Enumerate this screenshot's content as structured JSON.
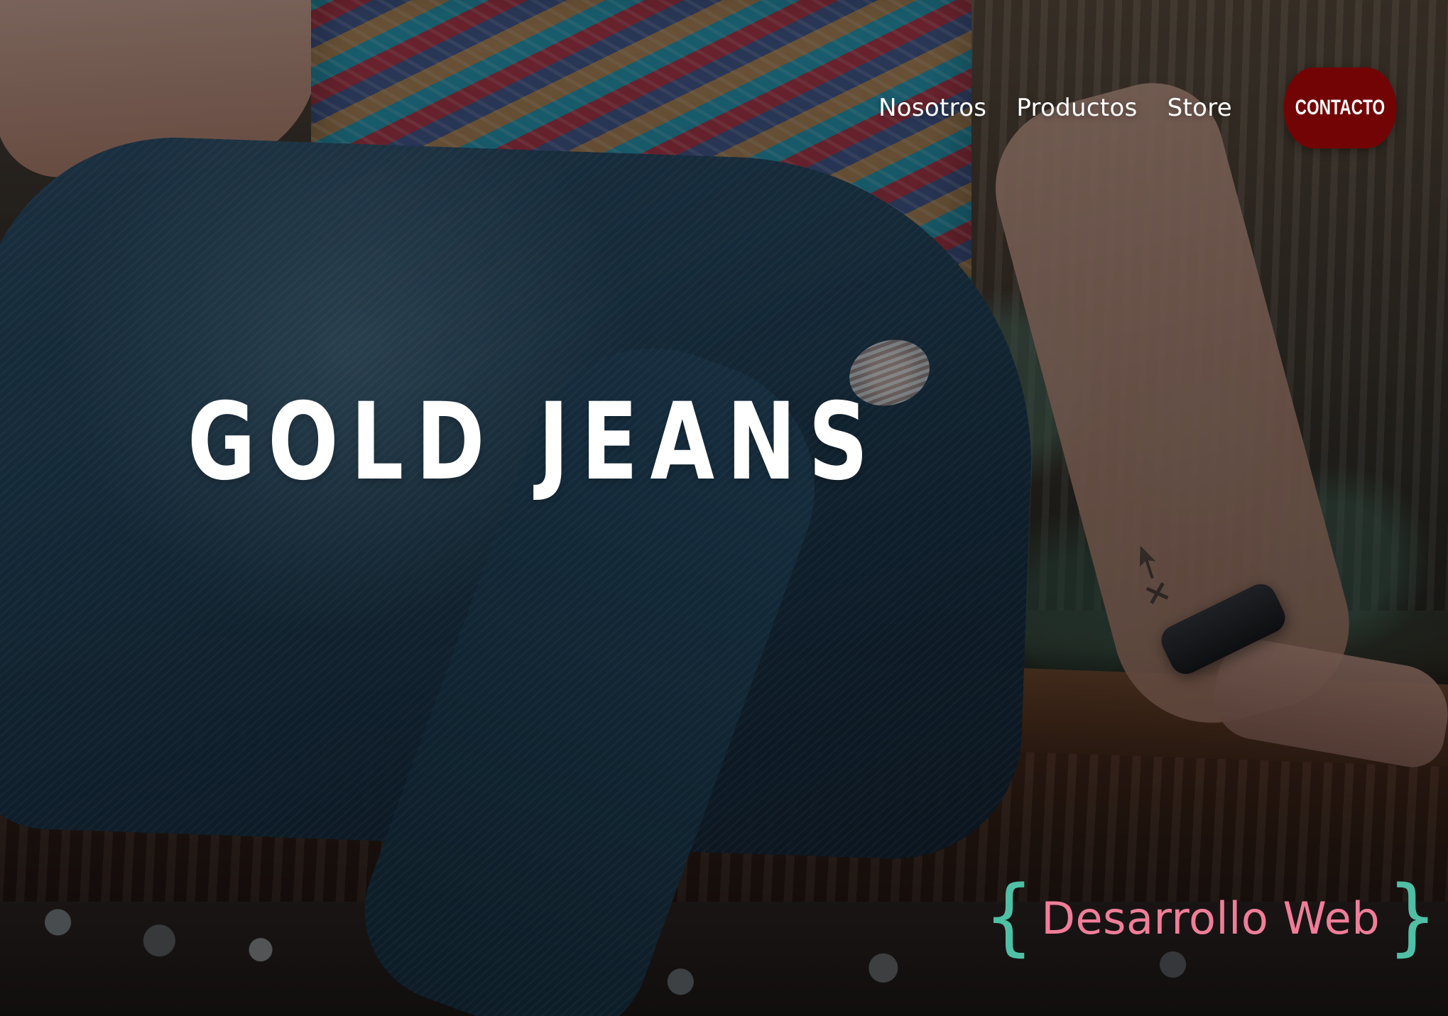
{
  "header": {
    "nav": [
      {
        "label": "Nosotros"
      },
      {
        "label": "Productos"
      },
      {
        "label": "Store"
      }
    ],
    "contact_label": "CONTACTO"
  },
  "hero": {
    "title": "GOLD JEANS"
  },
  "watermark": {
    "left_brace": "{",
    "label": "Desarrollo Web",
    "right_brace": "}"
  },
  "colors": {
    "contact_button": "#730405",
    "nav_text": "#ffffff",
    "title_text": "#ffffff",
    "watermark_brace": "#4fc0a5",
    "watermark_text": "#f07d99"
  },
  "icons": {
    "tattoo": "arrow-and-x-tattoo"
  }
}
